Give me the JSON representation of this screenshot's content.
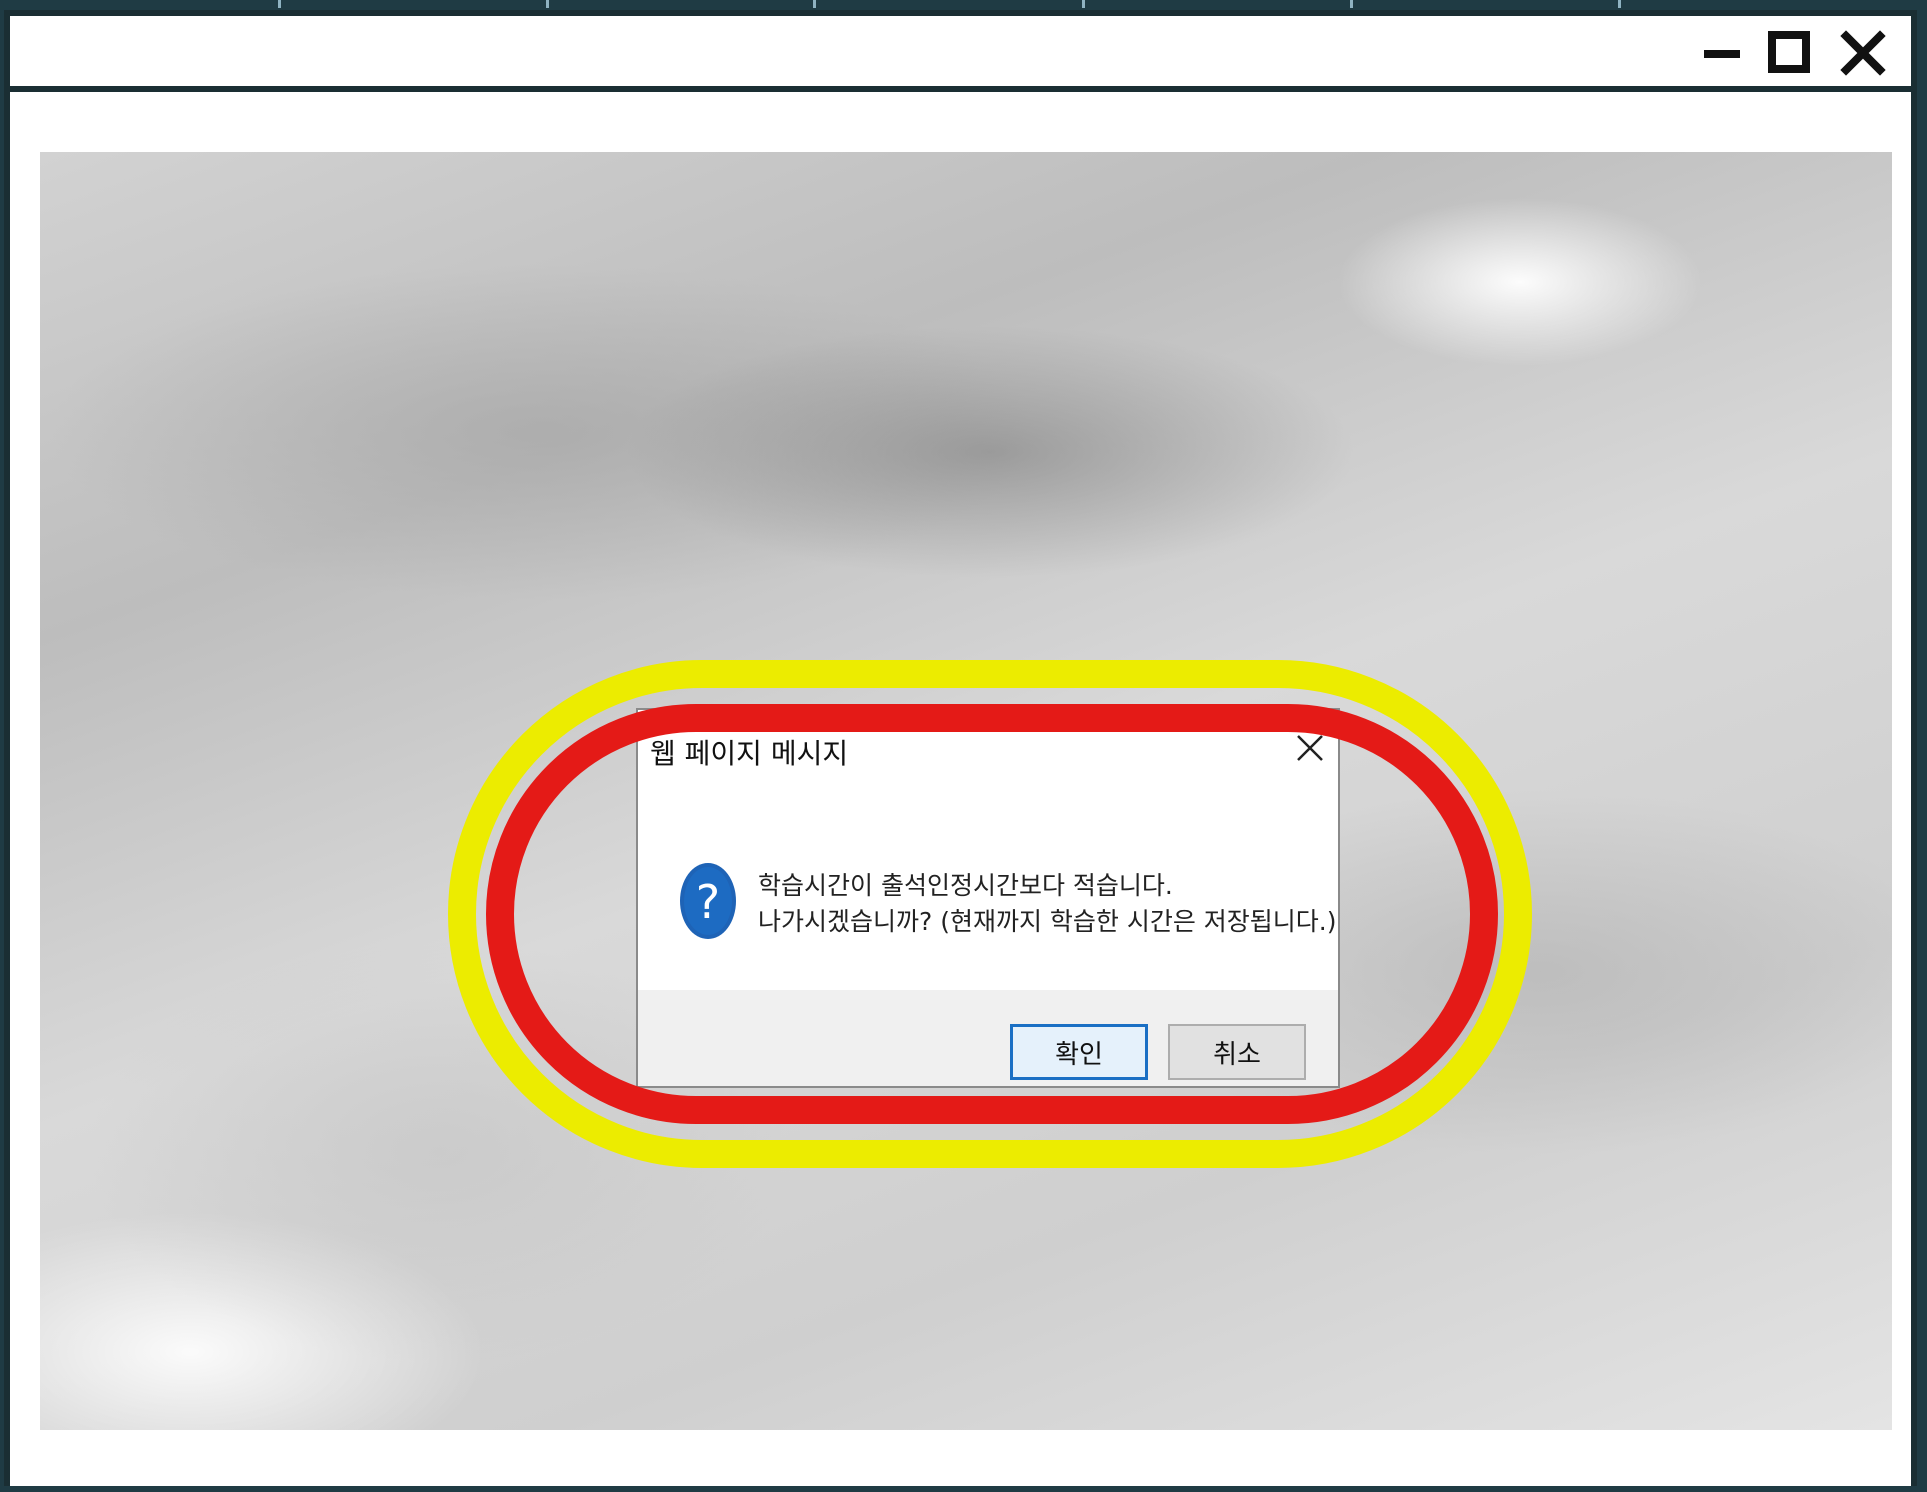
{
  "window": {
    "controls": {
      "minimize_icon": "minimize-icon",
      "maximize_icon": "maximize-icon",
      "close_icon": "close-icon"
    }
  },
  "dialog": {
    "title": "웹 페이지 메시지",
    "icon": "question-icon",
    "message_line1": "학습시간이 출석인정시간보다 적습니다.",
    "message_line2": "나가시겠습니까? (현재까지 학습한 시간은 저장됩니다.)",
    "ok_label": "확인",
    "cancel_label": "취소"
  },
  "annotations": {
    "outer_ring_color": "#ecec00",
    "inner_ring_color": "#e41a17"
  }
}
